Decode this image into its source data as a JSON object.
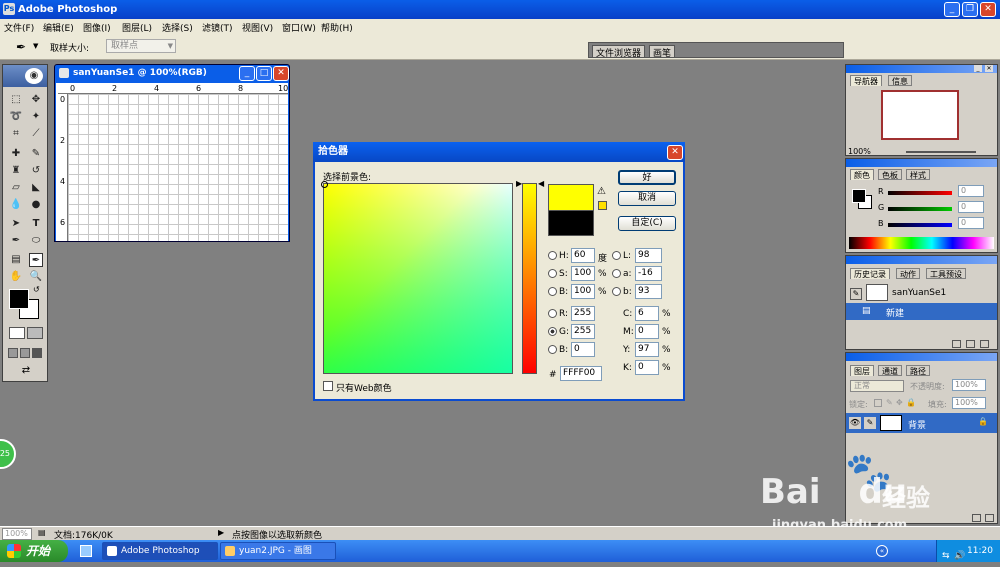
{
  "app": {
    "title": "Adobe Photoshop"
  },
  "menu": [
    "文件(F)",
    "编辑(E)",
    "图像(I)",
    "图层(L)",
    "选择(S)",
    "滤镜(T)",
    "视图(V)",
    "窗口(W)",
    "帮助(H)"
  ],
  "options": {
    "sample_size_label": "取样大小:",
    "sample_size_value": "取样点",
    "tab_file_browser": "文件浏览器",
    "tab_brushes": "画笔"
  },
  "document": {
    "title": "sanYuanSe1 @ 100%(RGB)",
    "ruler_h": [
      "0",
      "2",
      "4",
      "6",
      "8",
      "10"
    ],
    "ruler_v": [
      "0",
      "2",
      "4",
      "6"
    ]
  },
  "picker": {
    "title": "拾色器",
    "prompt": "选择前景色:",
    "buttons": {
      "ok": "好",
      "cancel": "取消",
      "custom": "自定(C)"
    },
    "hsb": [
      {
        "label": "H:",
        "value": "60",
        "unit": "度"
      },
      {
        "label": "S:",
        "value": "100",
        "unit": "%"
      },
      {
        "label": "B:",
        "value": "100",
        "unit": "%"
      }
    ],
    "lab": [
      {
        "label": "L:",
        "value": "98"
      },
      {
        "label": "a:",
        "value": "-16"
      },
      {
        "label": "b:",
        "value": "93"
      }
    ],
    "rgb": [
      {
        "label": "R:",
        "value": "255"
      },
      {
        "label": "G:",
        "value": "255"
      },
      {
        "label": "B:",
        "value": "0"
      }
    ],
    "cmyk": [
      {
        "label": "C:",
        "value": "6",
        "unit": "%"
      },
      {
        "label": "M:",
        "value": "0",
        "unit": "%"
      },
      {
        "label": "Y:",
        "value": "97",
        "unit": "%"
      },
      {
        "label": "K:",
        "value": "0",
        "unit": "%"
      }
    ],
    "hex_label": "#",
    "hex": "FFFF00",
    "web_only": "只有Web颜色",
    "new_color": "#ffff00",
    "old_color": "#000000"
  },
  "panels": {
    "navigator": {
      "tabs": [
        "导航器",
        "信息"
      ],
      "zoom": "100%"
    },
    "color": {
      "tabs": [
        "颜色",
        "色板",
        "样式"
      ],
      "sliders": [
        {
          "label": "R",
          "value": "0"
        },
        {
          "label": "G",
          "value": "0"
        },
        {
          "label": "B",
          "value": "0"
        }
      ]
    },
    "history": {
      "tabs": [
        "历史记录",
        "动作",
        "工具预设"
      ],
      "snapshot": "sanYuanSe1",
      "item": "新建"
    },
    "layers": {
      "tabs": [
        "图层",
        "通道",
        "路径"
      ],
      "mode": "正常",
      "opacity_label": "不透明度:",
      "opacity": "100%",
      "lock_label": "锁定:",
      "fill_label": "填充:",
      "fill": "100%",
      "layer_name": "背景"
    }
  },
  "status": {
    "zoom": "100%",
    "doc": "文档:176K/0K",
    "hint": "点按图像以选取新颜色"
  },
  "taskbar": {
    "start": "开始",
    "tasks": [
      "Adobe Photoshop",
      "yuan2.JPG - 画图"
    ],
    "clock": "11:20"
  },
  "overlay": {
    "badge": "25",
    "brand": "Bai",
    "brand_du": "du",
    "brand_cn": "经验",
    "url": "jingyan.baidu.com"
  }
}
